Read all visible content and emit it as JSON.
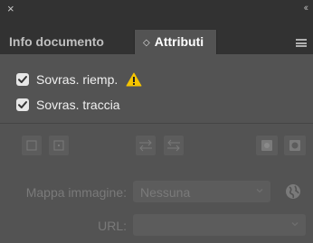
{
  "topbar": {
    "close_glyph": "×",
    "collapse_glyph": "‹‹"
  },
  "tabs": [
    {
      "label": "Info documento"
    },
    {
      "label": "Attributi",
      "prefix": "◇"
    }
  ],
  "checkboxes": [
    {
      "label": "Sovras. riemp.",
      "checked": true,
      "warning": true
    },
    {
      "label": "Sovras. traccia",
      "checked": true
    }
  ],
  "image_map": {
    "label": "Mappa immagine:",
    "value": "Nessuna"
  },
  "url": {
    "label": "URL:",
    "value": ""
  },
  "colors": {
    "panel_bg": "#535353",
    "bar_bg": "#323232",
    "warning": "#f5c400",
    "disabled_text": "#7a7a7a"
  },
  "icons": [
    "close-icon",
    "collapse-icon",
    "panel-menu-icon",
    "checkbox-check-icon",
    "warning-icon",
    "show-center-off-icon",
    "show-center-on-icon",
    "reverse-path-direction-off-icon",
    "reverse-path-direction-on-icon",
    "nonzero-winding-fill-rule-icon",
    "even-odd-fill-rule-icon",
    "chevron-down-icon",
    "browser-globe-icon"
  ]
}
